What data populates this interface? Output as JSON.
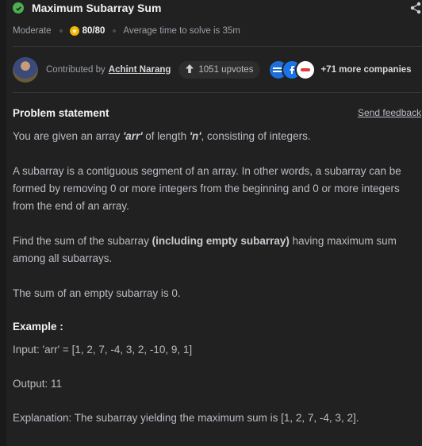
{
  "header": {
    "title": "Maximum Subarray Sum",
    "difficulty": "Moderate",
    "score": "80/80",
    "avg_time": "Average time to solve is 35m"
  },
  "contributor": {
    "label": "Contributed by",
    "name": "Achint Narang",
    "upvotes": "1051 upvotes",
    "company_logos": [
      "logo-blue",
      "logo-f",
      "logo-aea"
    ],
    "more_companies": "+71 more companies"
  },
  "problem": {
    "heading": "Problem statement",
    "send_feedback": "Send feedback",
    "p1": {
      "before": "You are given an array ",
      "arr": "'arr'",
      "mid": " of length ",
      "n": "'n'",
      "after": ", consisting of integers."
    },
    "p2": "A subarray is a contiguous segment of an array. In other words, a subarray can be formed by removing 0 or more integers from the beginning and 0 or more integers from the end of an array.",
    "p3": {
      "before": "Find the sum of the subarray ",
      "bold": "(including empty subarray)",
      "after": " having maximum sum among all subarrays."
    },
    "p4": "The sum of an empty subarray is 0."
  },
  "example": {
    "heading": "Example :",
    "input": "Input: 'arr' = [1, 2, 7, -4, 3, 2, -10, 9, 1]",
    "output": "Output: 11",
    "explanation": "Explanation: The subarray yielding the maximum sum is [1, 2, 7, -4, 3, 2]."
  },
  "colors": {
    "background": "#212121",
    "success": "#4caf50",
    "coin": "#f5b400"
  }
}
